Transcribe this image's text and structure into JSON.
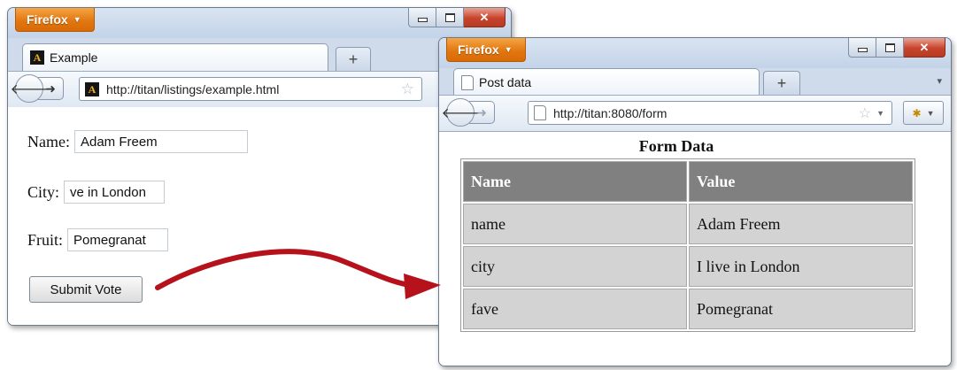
{
  "window1": {
    "firefox_label": "Firefox",
    "tab_title": "Example",
    "url": "http://titan/listings/example.html",
    "form": {
      "name_label": "Name:",
      "name_value": "Adam Freem",
      "city_label": "City:",
      "city_value": "ve in London",
      "fruit_label": "Fruit:",
      "fruit_value": "Pomegranat",
      "submit_label": "Submit Vote"
    }
  },
  "window2": {
    "firefox_label": "Firefox",
    "tab_title": "Post data",
    "url": "http://titan:8080/form",
    "table": {
      "title": "Form Data",
      "headers": [
        "Name",
        "Value"
      ],
      "rows": [
        [
          "name",
          "Adam Freem"
        ],
        [
          "city",
          "I live in London"
        ],
        [
          "fave",
          "Pomegranat"
        ]
      ]
    }
  },
  "colors": {
    "firefox_orange": "#e27811",
    "arrow_red": "#b5121b",
    "table_header": "#808080",
    "table_cell": "#d3d3d3"
  }
}
